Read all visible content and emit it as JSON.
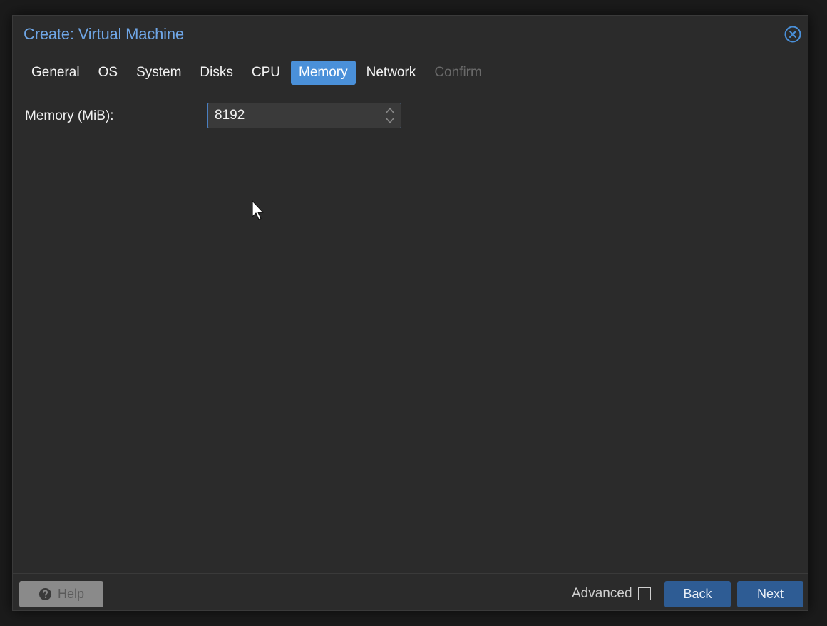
{
  "dialog": {
    "title": "Create: Virtual Machine"
  },
  "tabs": [
    {
      "label": "General",
      "state": "normal"
    },
    {
      "label": "OS",
      "state": "normal"
    },
    {
      "label": "System",
      "state": "normal"
    },
    {
      "label": "Disks",
      "state": "normal"
    },
    {
      "label": "CPU",
      "state": "normal"
    },
    {
      "label": "Memory",
      "state": "active"
    },
    {
      "label": "Network",
      "state": "normal"
    },
    {
      "label": "Confirm",
      "state": "disabled"
    }
  ],
  "memory": {
    "label": "Memory (MiB):",
    "value": "8192"
  },
  "footer": {
    "help_label": "Help",
    "advanced_label": "Advanced",
    "advanced_checked": false,
    "back_label": "Back",
    "next_label": "Next"
  },
  "icons": {
    "close": "close-circle-icon",
    "spinner": "spinner-arrows-icon",
    "help": "question-circle-icon",
    "cursor": "mouse-pointer-icon"
  },
  "colors": {
    "accent": "#4a90d9",
    "title": "#6fa6e6",
    "button": "#2e5c94",
    "background": "#2b2b2b"
  }
}
